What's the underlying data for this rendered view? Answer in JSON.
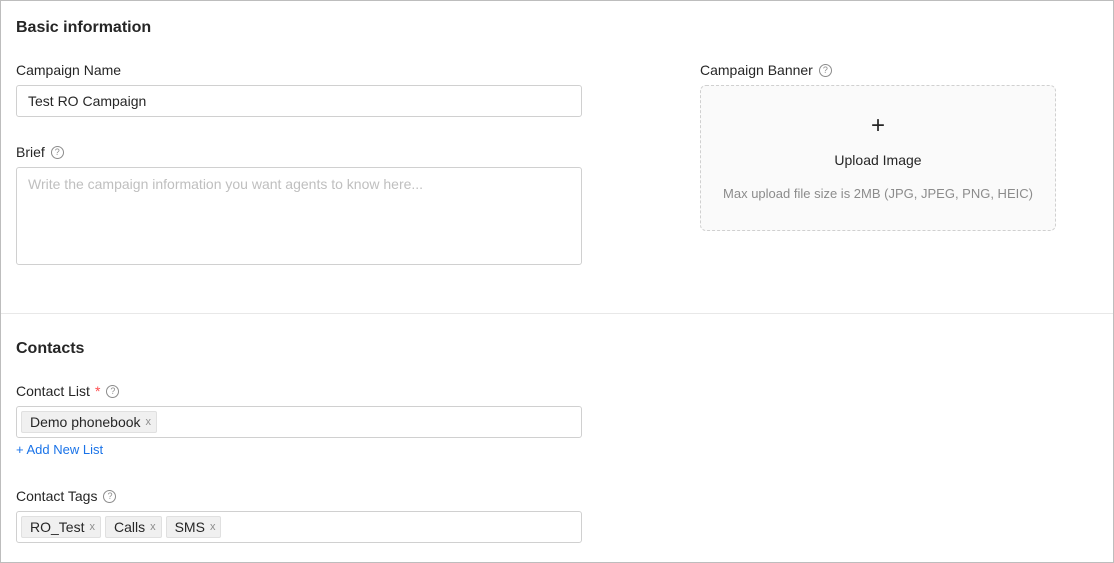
{
  "basic": {
    "title": "Basic information",
    "campaign_name_label": "Campaign Name",
    "campaign_name_value": "Test RO Campaign",
    "brief_label": "Brief",
    "brief_placeholder": "Write the campaign information you want agents to know here...",
    "banner_label": "Campaign Banner",
    "upload_plus": "+",
    "upload_title": "Upload Image",
    "upload_hint": "Max upload file size is 2MB (JPG, JPEG, PNG, HEIC)"
  },
  "contacts": {
    "title": "Contacts",
    "contact_list_label": "Contact List",
    "required_mark": "*",
    "contact_list_tags": [
      "Demo phonebook"
    ],
    "add_new_list": "+ Add New List",
    "contact_tags_label": "Contact Tags",
    "contact_tags": [
      "RO_Test",
      "Calls",
      "SMS"
    ]
  },
  "icons": {
    "help": "?",
    "tag_close": "x"
  },
  "colors": {
    "required": "#ff4d4f",
    "link": "#1a73e8"
  }
}
